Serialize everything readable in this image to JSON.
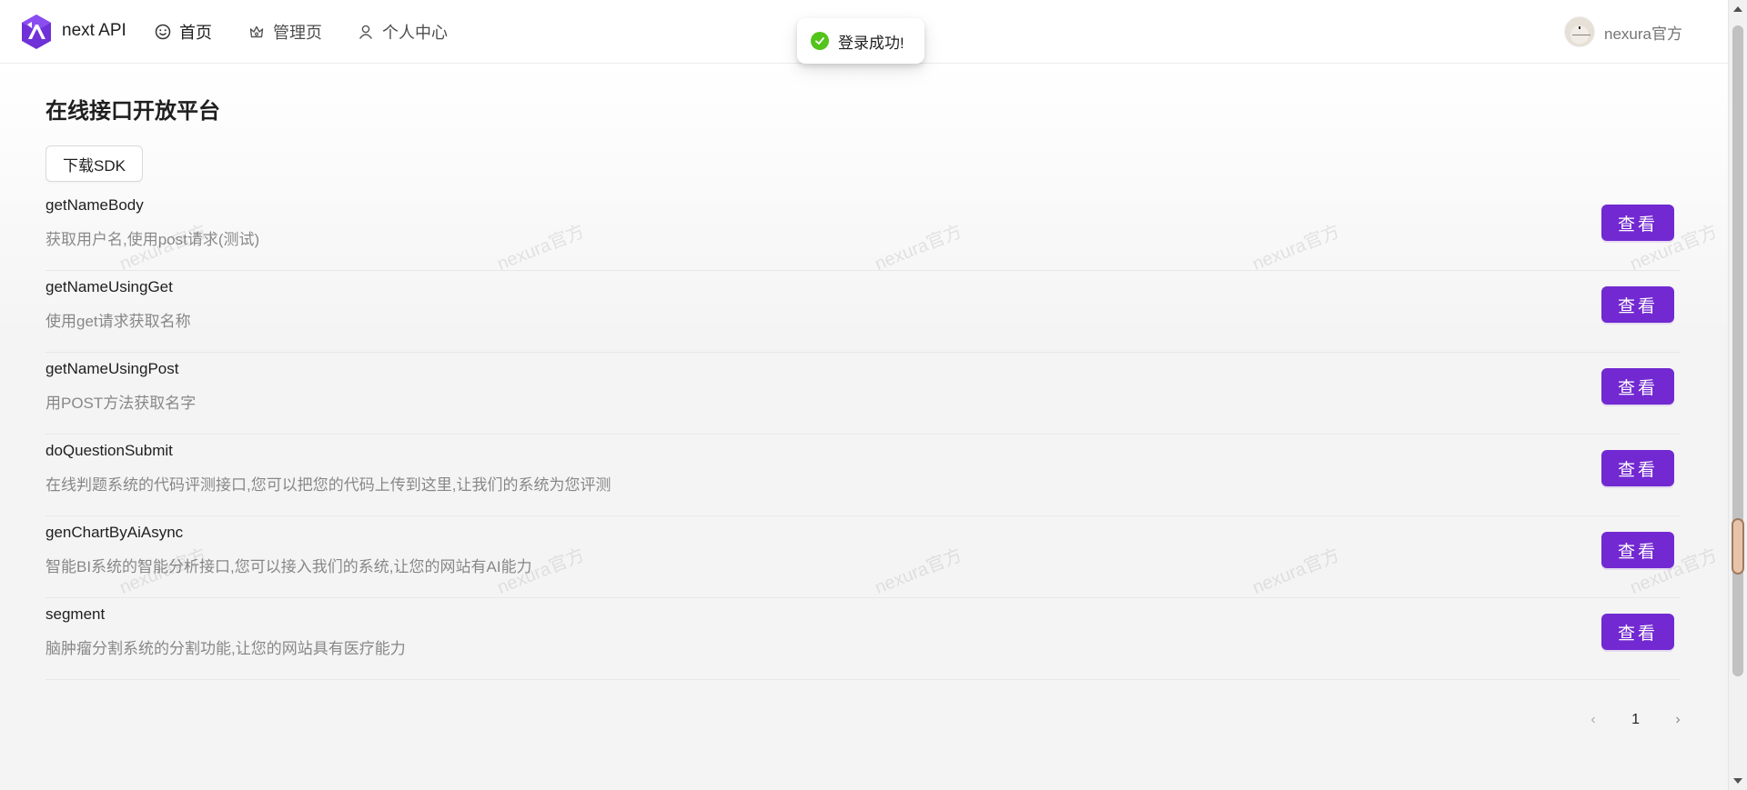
{
  "header": {
    "brand": "next API",
    "nav": [
      {
        "label": "首页",
        "icon": "smile-icon"
      },
      {
        "label": "管理页",
        "icon": "crown-icon"
      },
      {
        "label": "个人中心",
        "icon": "user-icon"
      }
    ],
    "user_name": "nexura官方"
  },
  "toast": {
    "message": "登录成功!",
    "icon": "check-circle-icon"
  },
  "main": {
    "page_title": "在线接口开放平台",
    "sdk_button": "下载SDK",
    "view_label": "查看",
    "items": [
      {
        "name": "getNameBody",
        "description": "获取用户名,使用post请求(测试)"
      },
      {
        "name": "getNameUsingGet",
        "description": "使用get请求获取名称"
      },
      {
        "name": "getNameUsingPost",
        "description": "用POST方法获取名字"
      },
      {
        "name": "doQuestionSubmit",
        "description": "在线判题系统的代码评测接口,您可以把您的代码上传到这里,让我们的系统为您评测"
      },
      {
        "name": "genChartByAiAsync",
        "description": "智能BI系统的智能分析接口,您可以接入我们的系统,让您的网站有AI能力"
      },
      {
        "name": "segment",
        "description": "脑肿瘤分割系统的分割功能,让您的网站具有医疗能力"
      }
    ],
    "pagination": {
      "current_page": "1",
      "prev_icon": "chevron-left-icon",
      "next_icon": "chevron-right-icon"
    }
  },
  "watermark": "nexura官方",
  "colors": {
    "primary": "#7229d1",
    "success": "#52c41a"
  }
}
